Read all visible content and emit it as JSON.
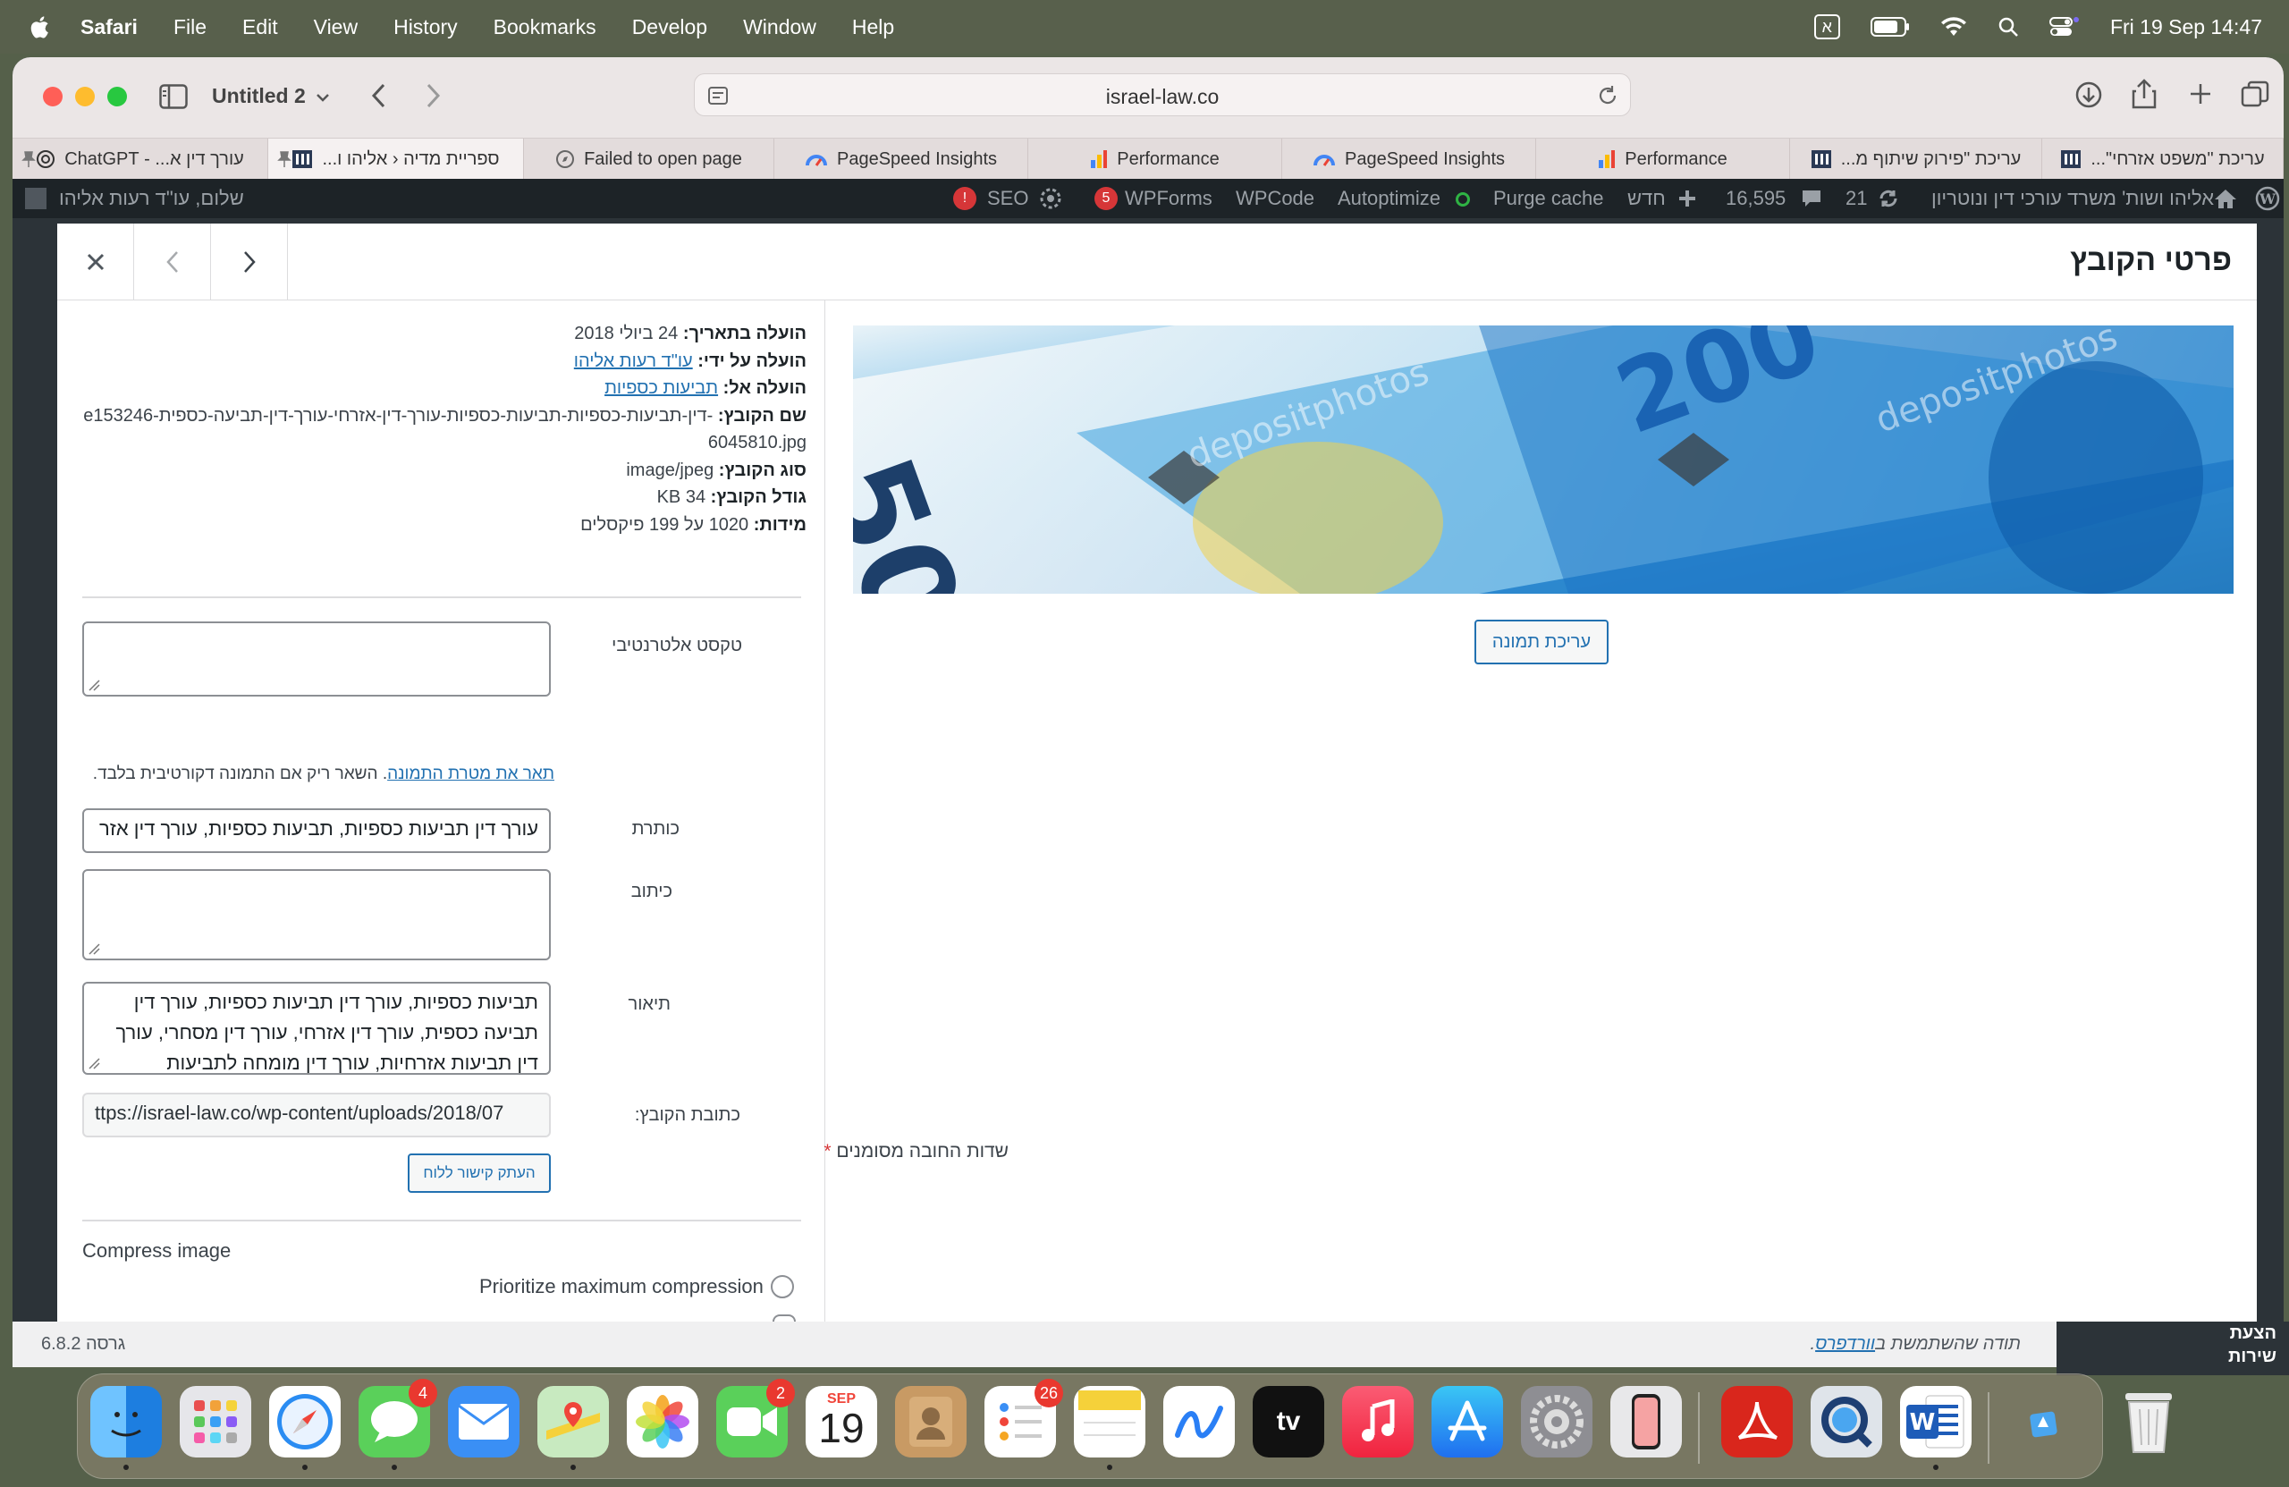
{
  "menubar": {
    "app": "Safari",
    "menus": [
      "File",
      "Edit",
      "View",
      "History",
      "Bookmarks",
      "Develop",
      "Window",
      "Help"
    ],
    "input_source": "א",
    "datetime": "Fri 19 Sep  14:47"
  },
  "browser": {
    "tab_group": "Untitled 2",
    "url": "israel-law.co",
    "tabs": [
      {
        "label": "עורך דין א... - ChatGPT",
        "pinned": true
      },
      {
        "label": "ספריית מדיה ‹ אליהו ו...",
        "pinned": true,
        "active": true
      },
      {
        "label": "Failed to open page"
      },
      {
        "label": "PageSpeed Insights"
      },
      {
        "label": "Performance"
      },
      {
        "label": "PageSpeed Insights"
      },
      {
        "label": "Performance"
      },
      {
        "label": "עריכת \"פירוק שיתוף מ..."
      },
      {
        "label": "עריכת \"משפט אזרחי\"..."
      }
    ]
  },
  "adminbar": {
    "greeting": "שלום, עו\"ד רעות אליהו",
    "seo": "SEO",
    "seo_count": "!",
    "wpforms": "WPForms",
    "wpforms_count": "5",
    "wpcode": "WPCode",
    "autoptimize": "Autoptimize",
    "purge": "Purge cache",
    "new": "חדש",
    "comments": "16,595",
    "updates": "21",
    "site": "אליהו ושות' משרד עורכי דין ונוטריון"
  },
  "modal": {
    "title": "פרטי הקובץ",
    "edit_image": "עריכת תמונה",
    "meta": {
      "uploaded_on_label": "הועלה בתאריך:",
      "uploaded_on": "24 ביולי 2018",
      "uploaded_by_label": "הועלה על ידי:",
      "uploaded_by": "עו\"ד רעות אליהו",
      "uploaded_to_label": "הועלה אל:",
      "uploaded_to": "תביעות כספיות",
      "file_name_label": "שם הקובץ:",
      "file_name": "-דין-תביעות-כספיות-תביעות-כספיות-עורך-דין-אזרחי-עורך-דין-תביעה-כספית-e1532466045810.jpg",
      "file_type_label": "סוג הקובץ:",
      "file_type": "image/jpeg",
      "file_size_label": "גודל הקובץ:",
      "file_size": "34 KB",
      "dimensions_label": "מידות:",
      "dimensions": "1020 על 199 פיקסלים"
    },
    "alt": {
      "label": "טקסט אלטרנטיבי",
      "value": ""
    },
    "alt_hint_link": "תאר את מטרת התמונה",
    "alt_hint_text": ". השאר ריק אם התמונה דקורטיבית בלבד.",
    "caption_title": {
      "label": "כותרת",
      "value": "עורך דין תביעות כספיות, תביעות כספיות, עורך דין אזר"
    },
    "caption": {
      "label": "כיתוב",
      "value": ""
    },
    "description": {
      "label": "תיאור",
      "value": "תביעות כספיות, עורך דין תביעות כספיות, עורך דין תביעה כספית, עורך דין אזרחי, עורך דין מסחרי, עורך דין תביעות אזרחיות, עורך דין מומחה לתביעות"
    },
    "file_url": {
      "label": "כתובת הקובץ:",
      "value": "ttps://israel-law.co/wp-content/uploads/2018/07"
    },
    "copy_link": "העתק קישור ללוח",
    "required_note": "שדות החובה מסומנים",
    "required_star": "*",
    "compress_title": "Compress image",
    "compress_option": "Prioritize maximum compression"
  },
  "footer": {
    "thanks_prefix": "תודה שהשתמשת ב",
    "thanks_link": "וורדפרס",
    "thanks_suffix": ".",
    "version": "גרסה 6.8.2"
  },
  "side_widget": {
    "line1": "הצעת",
    "line2": "שירות"
  },
  "dock": {
    "calendar_month": "SEP",
    "calendar_day": "19",
    "messages_badge": "4",
    "facetime_badge": "2",
    "reminders_badge": "26"
  },
  "colors": {
    "accent": "#2271b1",
    "admin_bar": "#1d2327",
    "required": "#d63638"
  }
}
